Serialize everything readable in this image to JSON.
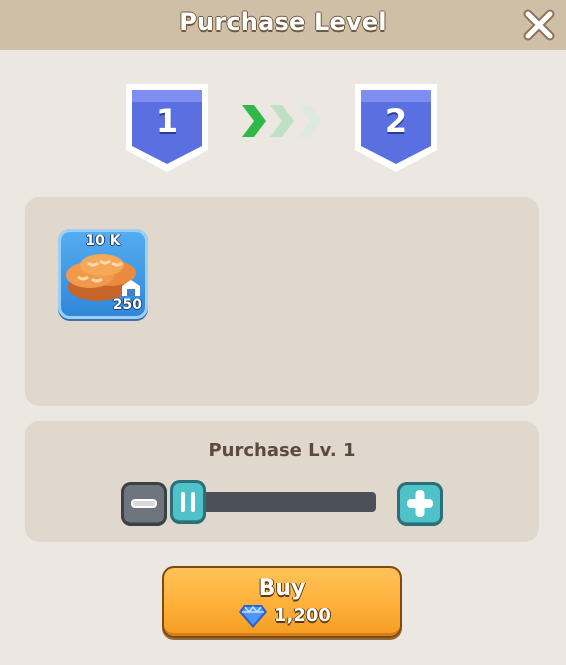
{
  "dialog": {
    "title": "Purchase Level"
  },
  "levels": {
    "current": "1",
    "next": "2",
    "arrow_count": 3,
    "active_arrows": 1
  },
  "reward": {
    "icon": "bread-icon",
    "amount": "10 K",
    "capacity": "250",
    "capacity_icon": "warehouse-icon"
  },
  "purchase": {
    "label": "Purchase Lv. 1",
    "slider_fraction": 0
  },
  "buy": {
    "label": "Buy",
    "price": "1,200",
    "currency_icon": "gem-icon"
  },
  "colors": {
    "title_bar": "#cfbfa6",
    "badge_blue": "#5a6fe0",
    "arrow_active": "#2fb84a",
    "arrow_inactive": "#cfe6d2",
    "buy_orange": "#ffb23c",
    "teal_button": "#4fc1c9"
  }
}
